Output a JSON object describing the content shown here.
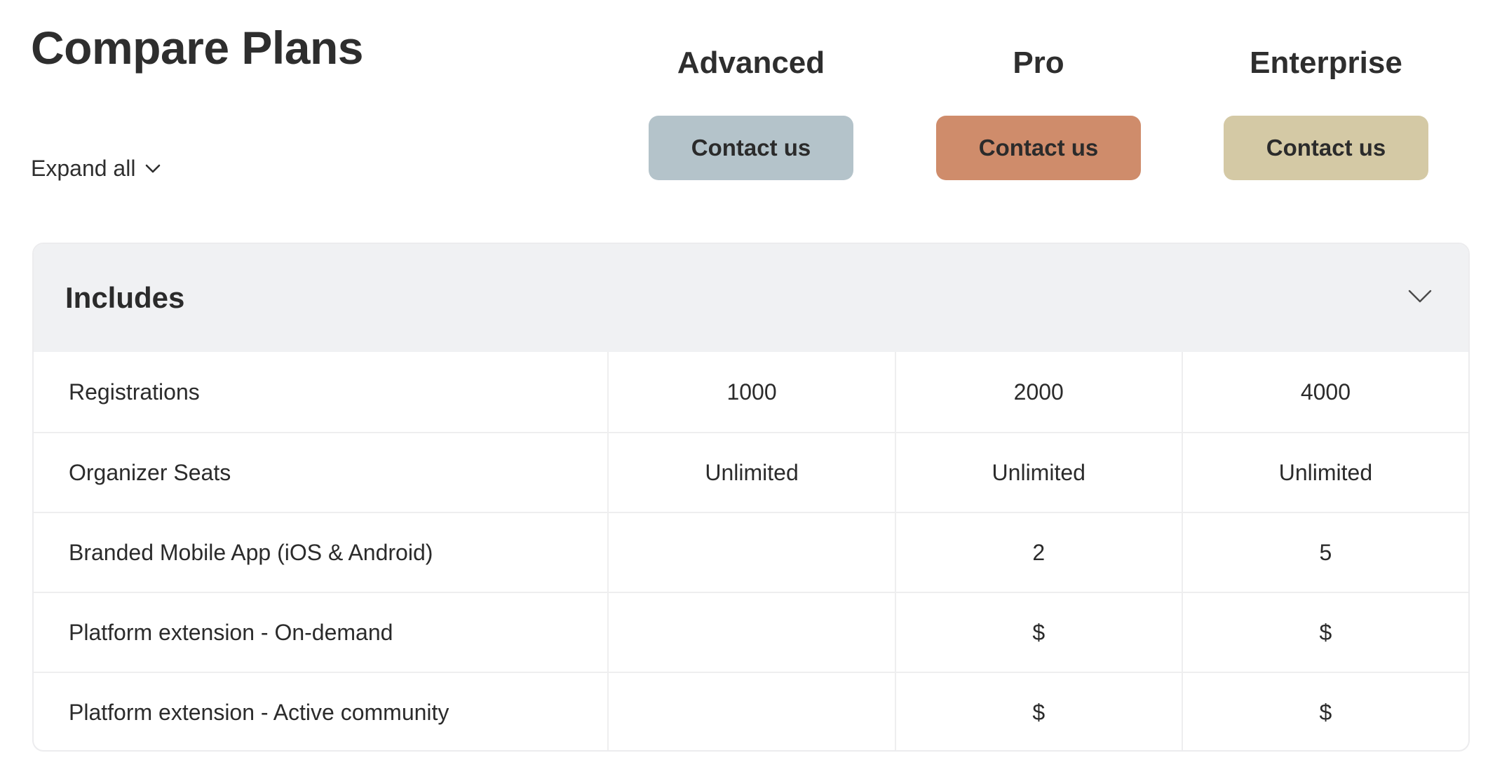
{
  "header": {
    "title": "Compare Plans",
    "expand_all_label": "Expand all"
  },
  "plans": [
    {
      "name": "Advanced",
      "button_label": "Contact us",
      "button_color": "#b4c3ca"
    },
    {
      "name": "Pro",
      "button_label": "Contact us",
      "button_color": "#cf8c6b"
    },
    {
      "name": "Enterprise",
      "button_label": "Contact us",
      "button_color": "#d4c9a5"
    }
  ],
  "section": {
    "title": "Includes",
    "toggle_icon": "chevron-down-icon",
    "rows": [
      {
        "feature": "Registrations",
        "values": [
          "1000",
          "2000",
          "4000"
        ]
      },
      {
        "feature": "Organizer Seats",
        "values": [
          "Unlimited",
          "Unlimited",
          "Unlimited"
        ]
      },
      {
        "feature": "Branded Mobile App (iOS & Android)",
        "values": [
          "",
          "2",
          "5"
        ]
      },
      {
        "feature": "Platform extension - On-demand",
        "values": [
          "",
          "$",
          "$"
        ]
      },
      {
        "feature": "Platform extension - Active community",
        "values": [
          "",
          "$",
          "$"
        ]
      }
    ]
  }
}
